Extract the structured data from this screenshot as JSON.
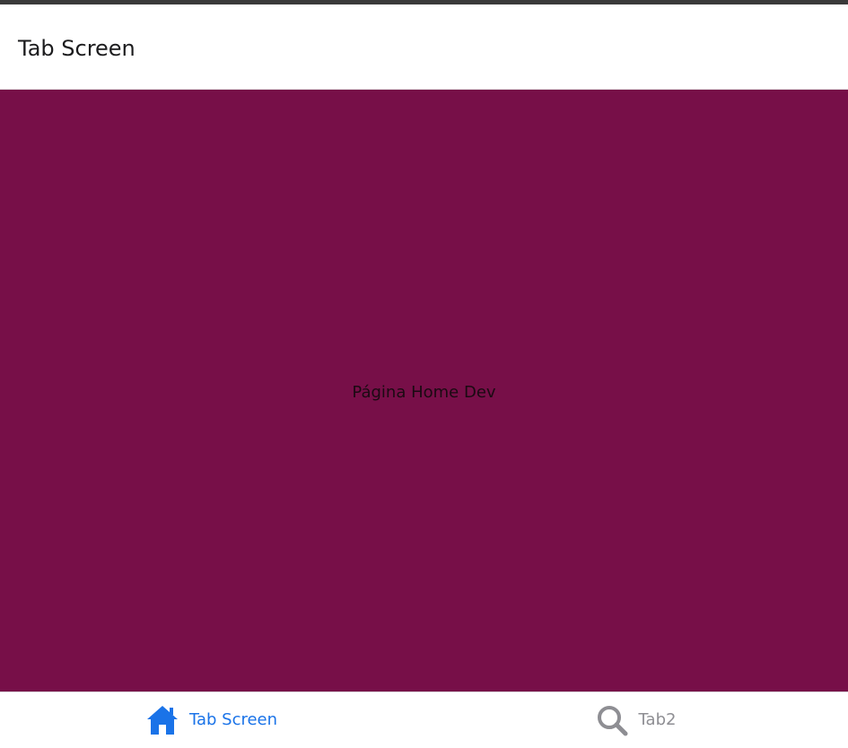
{
  "header": {
    "title": "Tab Screen"
  },
  "content": {
    "text": "Página Home Dev",
    "background": "#770f48"
  },
  "tabbar": {
    "tabs": [
      {
        "label": "Tab Screen",
        "icon": "home-icon",
        "active": true,
        "color": "#1a73e8"
      },
      {
        "label": "Tab2",
        "icon": "search-icon",
        "active": false,
        "color": "#8e8e93"
      }
    ]
  }
}
